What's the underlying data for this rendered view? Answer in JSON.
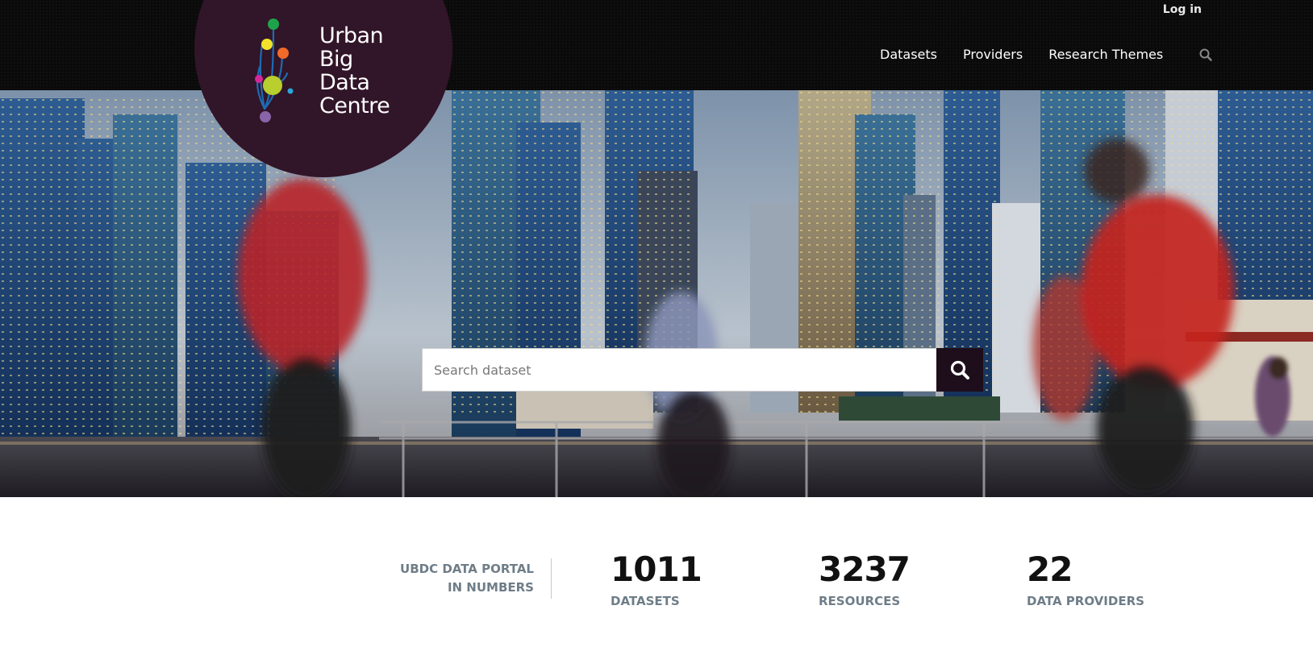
{
  "header": {
    "login_label": "Log in",
    "logo": {
      "line1": "Urban",
      "line2": "Big",
      "line3": "Data",
      "line4": "Centre",
      "disc_color": "#311528"
    },
    "nav": [
      {
        "label": "Datasets"
      },
      {
        "label": "Providers"
      },
      {
        "label": "Research Themes"
      }
    ],
    "search_icon": "search-icon"
  },
  "hero": {
    "search": {
      "placeholder": "Search dataset",
      "button_icon": "search-icon",
      "button_color": "#1e0e1b"
    }
  },
  "stats": {
    "label_line1": "UBDC DATA PORTAL",
    "label_line2": "IN NUMBERS",
    "items": [
      {
        "value": "1011",
        "label": "DATASETS"
      },
      {
        "value": "3237",
        "label": "RESOURCES"
      },
      {
        "value": "22",
        "label": "DATA PROVIDERS"
      }
    ]
  }
}
